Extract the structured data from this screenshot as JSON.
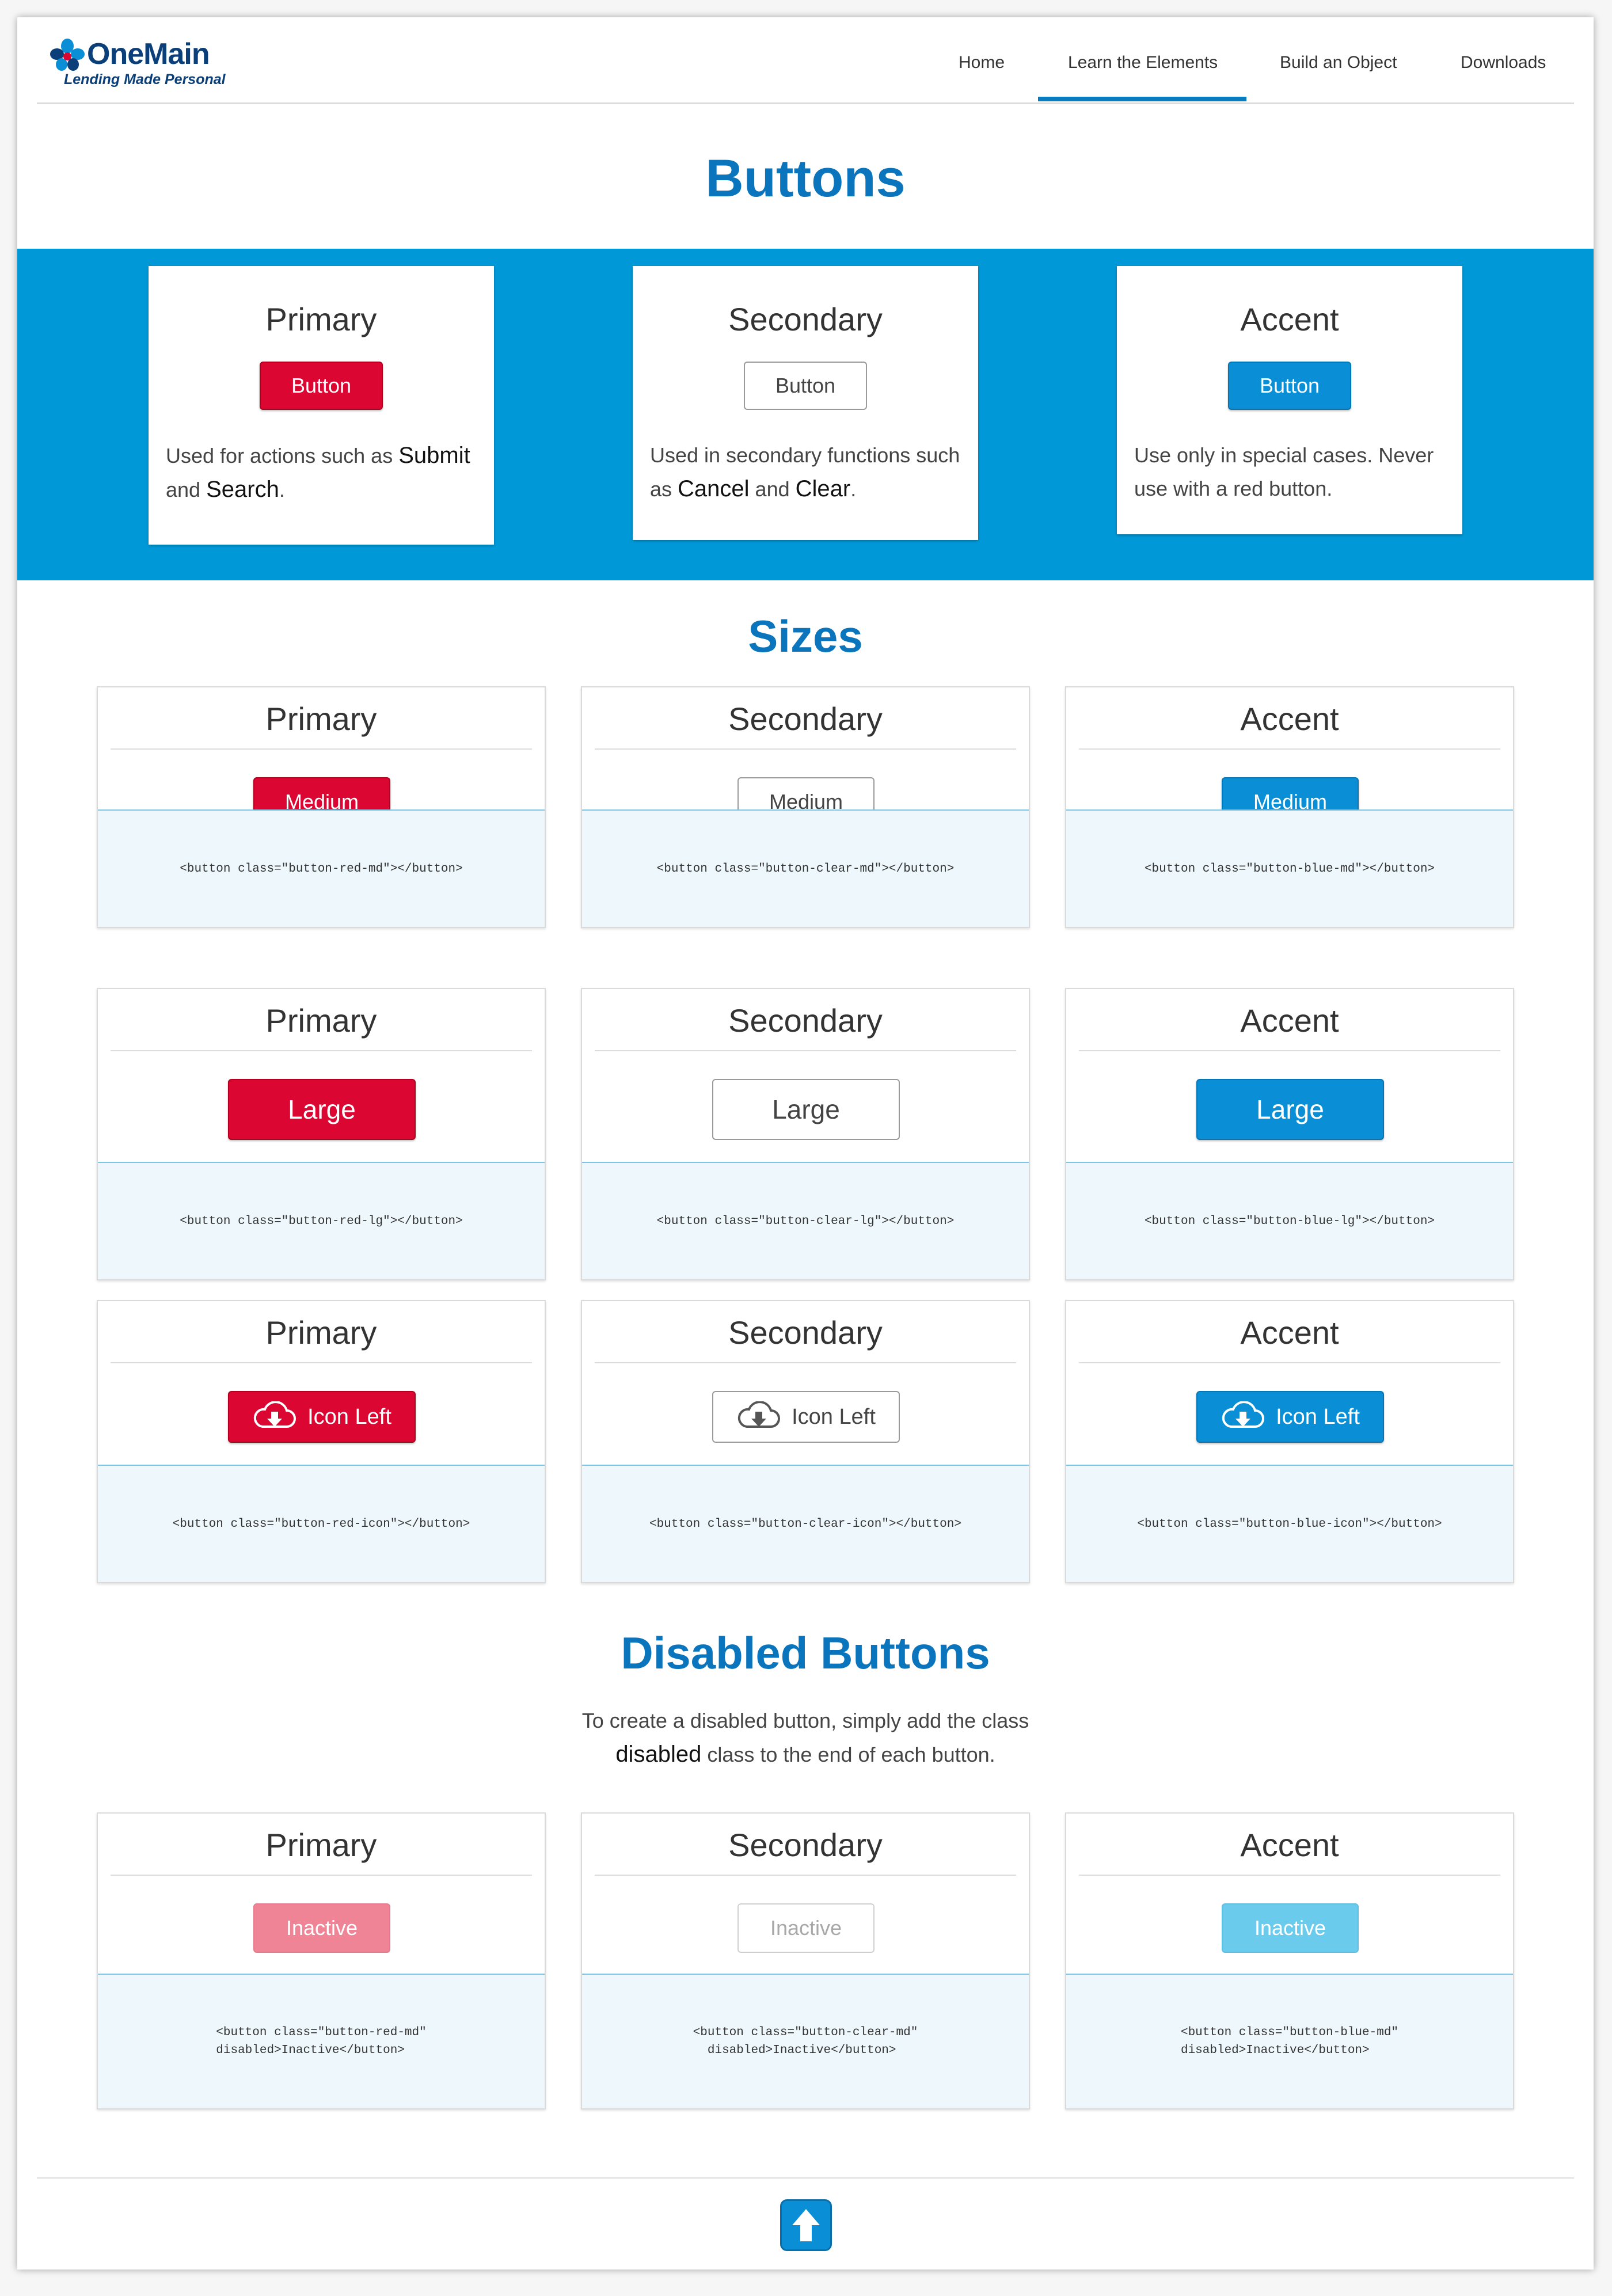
{
  "brand": {
    "name": "OneMain",
    "tagline": "Lending Made Personal"
  },
  "nav": {
    "items": [
      "Home",
      "Learn the Elements",
      "Build an Object",
      "Downloads"
    ],
    "active_index": 1
  },
  "page_title": "Buttons",
  "intro_cards": [
    {
      "title": "Primary",
      "button": "Button",
      "desc_pre": "Used for actions such as ",
      "desc_em1": "Submit",
      "desc_mid": "and ",
      "desc_em2": "Search",
      "desc_post": "."
    },
    {
      "title": "Secondary",
      "button": "Button",
      "desc_pre": "Used in secondary functions such as ",
      "desc_em1": "Cancel",
      "desc_mid": " and ",
      "desc_em2": "Clear",
      "desc_post": "."
    },
    {
      "title": "Accent",
      "button": "Button",
      "desc": "Use only in special cases. Never use with a red button."
    }
  ],
  "sizes_title": "Sizes",
  "sizes_rows": [
    [
      {
        "title": "Primary",
        "button": "Medium",
        "code": "<button class=\"button-red-md\"></button>"
      },
      {
        "title": "Secondary",
        "button": "Medium",
        "code": "<button class=\"button-clear-md\"></button>"
      },
      {
        "title": "Accent",
        "button": "Medium",
        "code": "<button class=\"button-blue-md\"></button>"
      }
    ],
    [
      {
        "title": "Primary",
        "button": "Large",
        "code": "<button class=\"button-red-lg\"></button>"
      },
      {
        "title": "Secondary",
        "button": "Large",
        "code": "<button class=\"button-clear-lg\"></button>"
      },
      {
        "title": "Accent",
        "button": "Large",
        "code": "<button class=\"button-blue-lg\"></button>"
      }
    ],
    [
      {
        "title": "Primary",
        "button": "Icon Left",
        "code": "<button class=\"button-red-icon\"></button>"
      },
      {
        "title": "Secondary",
        "button": "Icon Left",
        "code": "<button class=\"button-clear-icon\"></button>"
      },
      {
        "title": "Accent",
        "button": "Icon Left",
        "code": "<button class=\"button-blue-icon\"></button>"
      }
    ]
  ],
  "disabled_title": "Disabled Buttons",
  "disabled_desc": {
    "line1": "To create a disabled button, simply add the class",
    "em": "disabled",
    "line2_post": " class to the end of each button."
  },
  "disabled_cards": [
    {
      "title": "Primary",
      "button": "Inactive",
      "code": "<button class=\"button-red-md\"\ndisabled>Inactive</button>"
    },
    {
      "title": "Secondary",
      "button": "Inactive",
      "code": "<button class=\"button-clear-md\"\n  disabled>Inactive</button>"
    },
    {
      "title": "Accent",
      "button": "Inactive",
      "code": "<button class=\"button-blue-md\"\ndisabled>Inactive</button>"
    }
  ],
  "icons": {
    "button_icon": "cloud-download-icon",
    "back_to_top": "arrow-up-icon",
    "logo_mark": "onemain-flower-icon"
  },
  "colors": {
    "accent_blue": "#0198d7",
    "heading_blue": "#0a74bc",
    "primary_red": "#db0632",
    "code_bg": "#eef7fc"
  }
}
